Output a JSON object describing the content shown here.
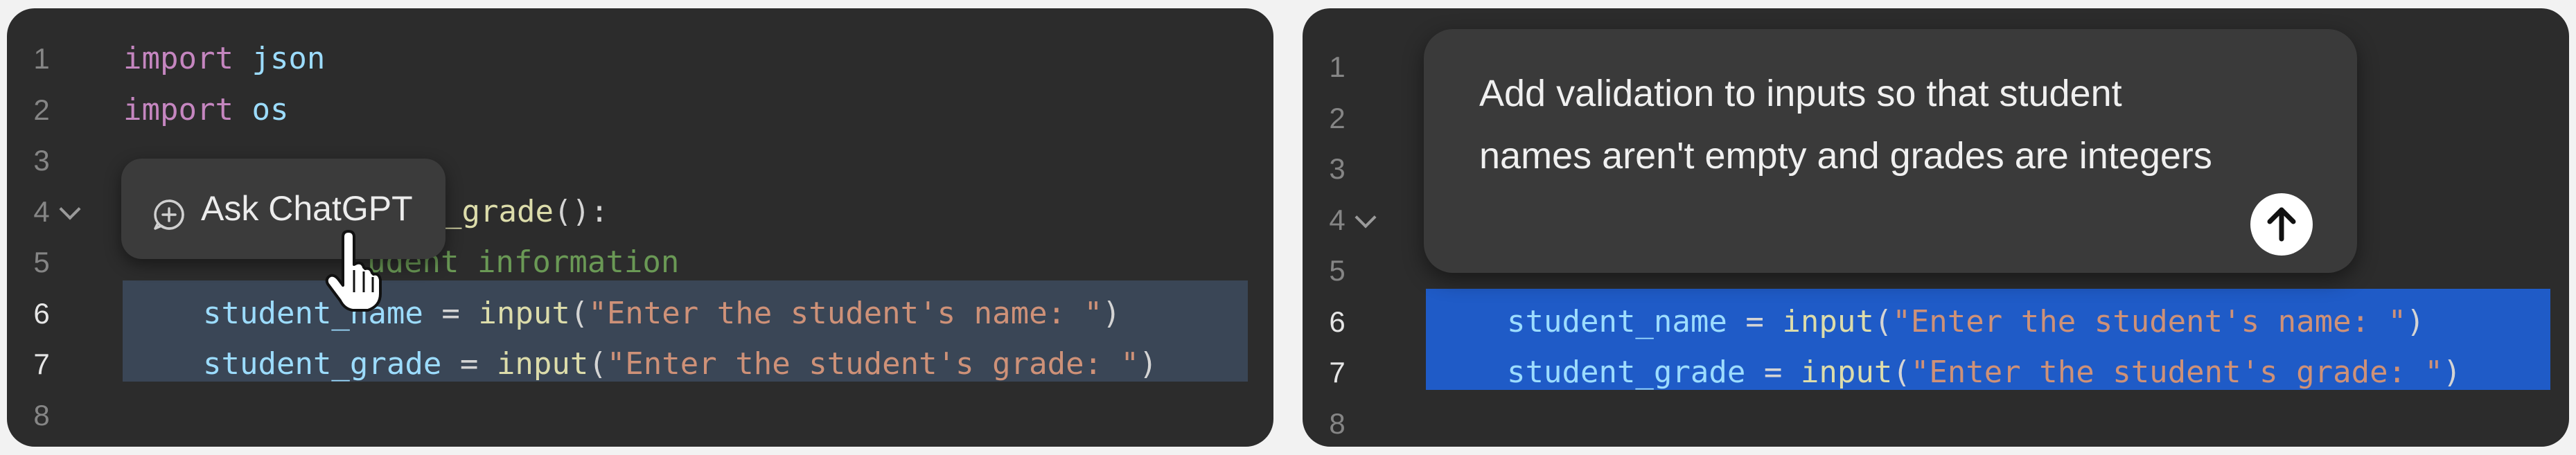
{
  "left_panel": {
    "chip": {
      "label": "Ask ChatGPT",
      "icon": "plus-chat-icon"
    },
    "lines": [
      {
        "num": "1",
        "tokens": [
          {
            "t": "import",
            "c": "kw"
          },
          {
            "t": " ",
            "c": "pn"
          },
          {
            "t": "json",
            "c": "id"
          }
        ]
      },
      {
        "num": "2",
        "tokens": [
          {
            "t": "import",
            "c": "kw"
          },
          {
            "t": " ",
            "c": "pn"
          },
          {
            "t": "os",
            "c": "id"
          }
        ]
      },
      {
        "num": "3",
        "tokens": []
      },
      {
        "num": "4",
        "tokens": [
          {
            "t": "_grade",
            "c": "fn"
          },
          {
            "t": "():",
            "c": "pn"
          }
        ]
      },
      {
        "num": "5",
        "tokens": [
          {
            "t": "udent information",
            "c": "cm"
          }
        ]
      },
      {
        "num": "6",
        "tokens": [
          {
            "t": "student_name",
            "c": "id"
          },
          {
            "t": " = ",
            "c": "op"
          },
          {
            "t": "input",
            "c": "fn"
          },
          {
            "t": "(",
            "c": "pn"
          },
          {
            "t": "\"Enter the student's name: \"",
            "c": "str"
          },
          {
            "t": ")",
            "c": "pn"
          }
        ]
      },
      {
        "num": "7",
        "tokens": [
          {
            "t": "student_grade",
            "c": "id"
          },
          {
            "t": " = ",
            "c": "op"
          },
          {
            "t": "input",
            "c": "fn"
          },
          {
            "t": "(",
            "c": "pn"
          },
          {
            "t": "\"Enter the student's grade: \"",
            "c": "str"
          },
          {
            "t": ")",
            "c": "pn"
          }
        ]
      },
      {
        "num": "8",
        "tokens": []
      }
    ]
  },
  "right_panel": {
    "prompt": {
      "text": "Add validation to inputs so that student names aren't empty and grades are integers",
      "send_icon": "arrow-up-icon"
    },
    "lines": [
      {
        "num": "1",
        "tokens": []
      },
      {
        "num": "2",
        "tokens": []
      },
      {
        "num": "3",
        "tokens": []
      },
      {
        "num": "4",
        "tokens": []
      },
      {
        "num": "5",
        "tokens": []
      },
      {
        "num": "6",
        "tokens": [
          {
            "t": "student_name",
            "c": "id"
          },
          {
            "t": " = ",
            "c": "op"
          },
          {
            "t": "input",
            "c": "fn"
          },
          {
            "t": "(",
            "c": "pn"
          },
          {
            "t": "\"Enter the student's name: \"",
            "c": "str"
          },
          {
            "t": ")",
            "c": "pn"
          }
        ]
      },
      {
        "num": "7",
        "tokens": [
          {
            "t": "student_grade",
            "c": "id"
          },
          {
            "t": " = ",
            "c": "op"
          },
          {
            "t": "input",
            "c": "fn"
          },
          {
            "t": "(",
            "c": "pn"
          },
          {
            "t": "\"Enter the student's grade: \"",
            "c": "str"
          },
          {
            "t": ")",
            "c": "pn"
          }
        ]
      },
      {
        "num": "8",
        "tokens": []
      }
    ]
  }
}
